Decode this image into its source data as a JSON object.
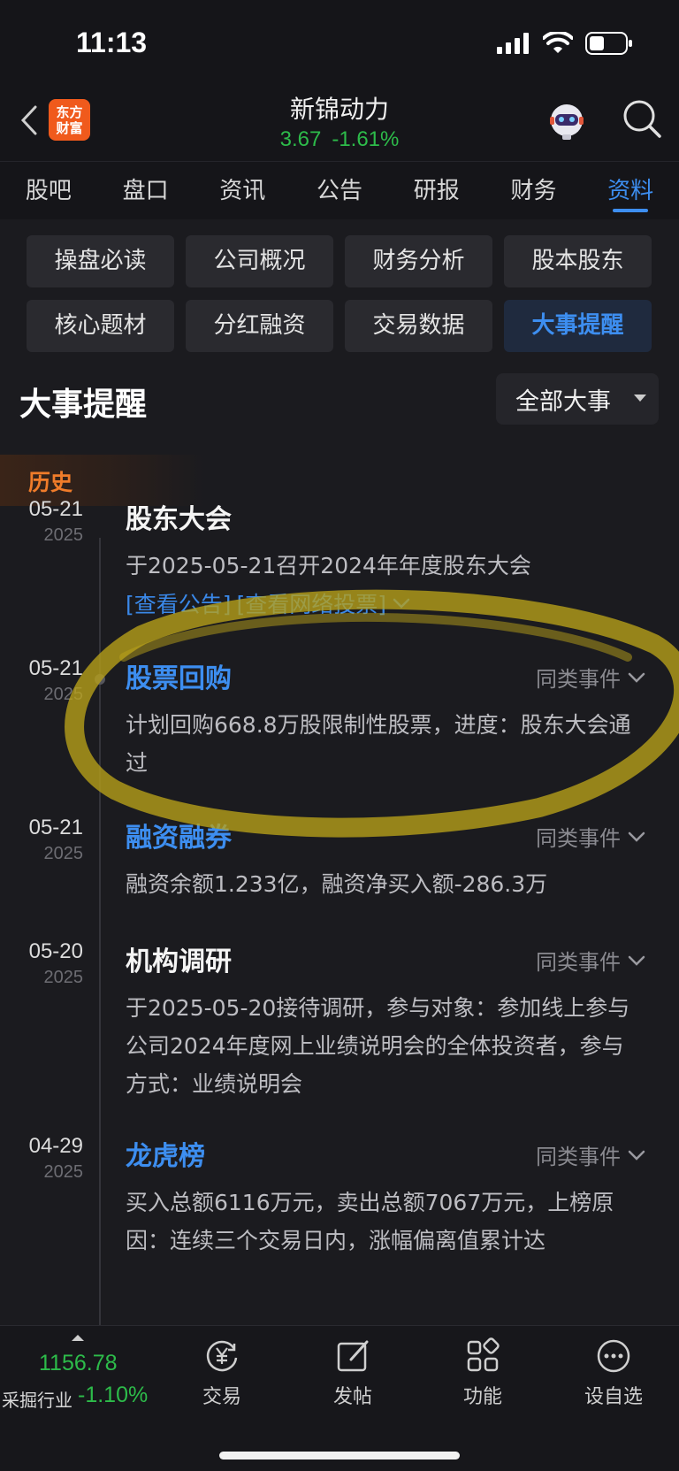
{
  "status": {
    "time": "11:13"
  },
  "header": {
    "logo_line1": "东方",
    "logo_line2": "财富",
    "stock_name": "新锦动力",
    "price": "3.67",
    "change": "-1.61%"
  },
  "tabs": [
    "股吧",
    "盘口",
    "资讯",
    "公告",
    "研报",
    "财务",
    "资料"
  ],
  "grid": [
    "操盘必读",
    "公司概况",
    "财务分析",
    "股本股东",
    "核心题材",
    "分红融资",
    "交易数据",
    "大事提醒"
  ],
  "section": {
    "title": "大事提醒",
    "filter": "全部大事",
    "history": "历史"
  },
  "events": [
    {
      "date": "05-21",
      "year": "2025",
      "title": "股东大会",
      "same": "",
      "desc": "于2025-05-21召开2024年年度股东大会",
      "link1": "[查看公告]",
      "link2": "[查看网络投票]"
    },
    {
      "date": "05-21",
      "year": "2025",
      "title": "股票回购",
      "same": "同类事件",
      "desc": "计划回购668.8万股限制性股票，进度：股东大会通过"
    },
    {
      "date": "05-21",
      "year": "2025",
      "title": "融资融券",
      "same": "同类事件",
      "desc": "融资余额1.233亿，融资净买入额-286.3万"
    },
    {
      "date": "05-20",
      "year": "2025",
      "title": "机构调研",
      "same": "同类事件",
      "desc": "于2025-05-20接待调研，参与对象：参加线上参与公司2024年度网上业绩说明会的全体投资者，参与方式：业绩说明会"
    },
    {
      "date": "04-29",
      "year": "2025",
      "title": "龙虎榜",
      "same": "同类事件",
      "desc": "买入总额6116万元，卖出总额7067万元，上榜原因：连续三个交易日内，涨幅偏离值累计达"
    }
  ],
  "bottom": {
    "index_value": "1156.78",
    "index_label": "采掘行业",
    "index_change": "-1.10%",
    "items": [
      "交易",
      "发帖",
      "功能",
      "设自选"
    ]
  },
  "colors": {
    "accent": "#3d8ef0",
    "down": "#2dbb4a",
    "history": "#f07c2a",
    "highlight": "#b9a11a"
  }
}
